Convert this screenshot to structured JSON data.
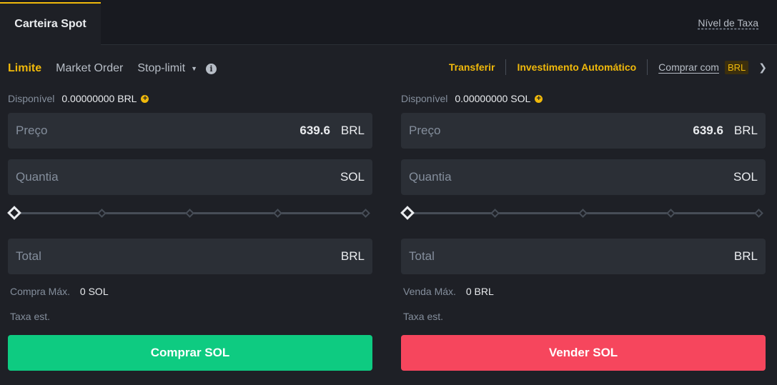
{
  "header": {
    "wallet_tab": "Carteira Spot",
    "fee_level": "Nível de Taxa"
  },
  "order_types": {
    "limit": "Limite",
    "market": "Market Order",
    "stop_limit": "Stop-limit"
  },
  "links": {
    "transfer": "Transferir",
    "auto_invest": "Investimento Automático",
    "buy_with": "Comprar com",
    "buy_with_currency": "BRL"
  },
  "buy": {
    "available_label": "Disponível",
    "available_value": "0.00000000 BRL",
    "price_placeholder": "Preço",
    "price_value": "639.6",
    "price_unit": "BRL",
    "amount_placeholder": "Quantia",
    "amount_unit": "SOL",
    "total_placeholder": "Total",
    "total_unit": "BRL",
    "max_label": "Compra Máx.",
    "max_value": "0 SOL",
    "fee_label": "Taxa est.",
    "button": "Comprar SOL",
    "slider_percent": 0
  },
  "sell": {
    "available_label": "Disponível",
    "available_value": "0.00000000 SOL",
    "price_placeholder": "Preço",
    "price_value": "639.6",
    "price_unit": "BRL",
    "amount_placeholder": "Quantia",
    "amount_unit": "SOL",
    "total_placeholder": "Total",
    "total_unit": "BRL",
    "max_label": "Venda Máx.",
    "max_value": "0 BRL",
    "fee_label": "Taxa est.",
    "button": "Vender SOL",
    "slider_percent": 0
  },
  "icons": {
    "info": "info-icon",
    "plus": "plus-circle-icon",
    "caret": "caret-down-icon",
    "chevron": "chevron-right-icon"
  },
  "colors": {
    "accent": "#f0b90b",
    "buy": "#0ecb81",
    "sell": "#f6465d",
    "background": "#1e2026"
  }
}
